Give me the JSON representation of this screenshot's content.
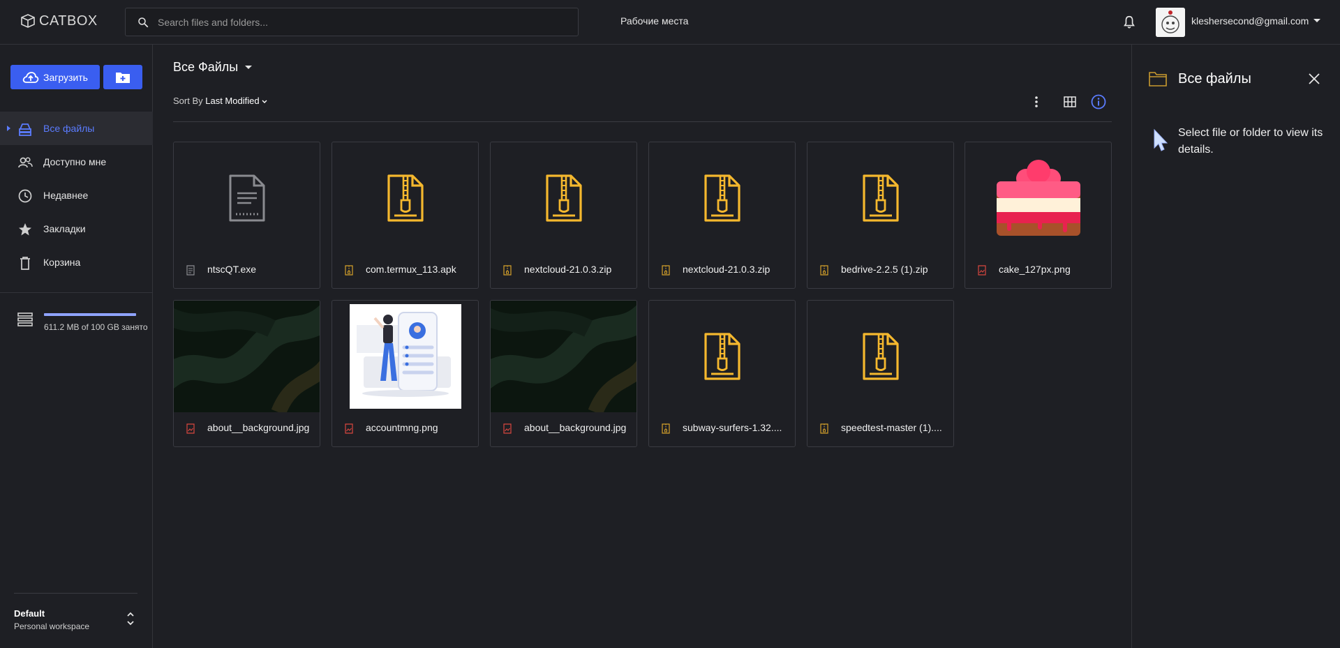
{
  "app": {
    "logo_text": "CATBOX"
  },
  "header": {
    "search_placeholder": "Search files and folders...",
    "workspaces_label": "Рабочие места",
    "user_email": "kleshersecond@gmail.com"
  },
  "sidebar": {
    "upload_label": "Загрузить",
    "nav": [
      {
        "label": "Все файлы",
        "icon": "all-files-icon",
        "active": true
      },
      {
        "label": "Доступно мне",
        "icon": "shared-people-icon"
      },
      {
        "label": "Недавнее",
        "icon": "clock-icon"
      },
      {
        "label": "Закладки",
        "icon": "star-icon"
      },
      {
        "label": "Корзина",
        "icon": "trash-icon"
      }
    ],
    "storage_text": "611.2 MB of 100 GB занято",
    "storage_fraction": 0.006,
    "workspace": {
      "name": "Default",
      "type": "Personal workspace"
    }
  },
  "main": {
    "title": "Все Файлы",
    "sort_prefix": "Sort By",
    "sort_value": "Last Modified",
    "files": [
      {
        "name": "ntscQT.exe",
        "kind": "document"
      },
      {
        "name": "com.termux_113.apk",
        "kind": "archive"
      },
      {
        "name": "nextcloud-21.0.3.zip",
        "kind": "archive"
      },
      {
        "name": "nextcloud-21.0.3.zip",
        "kind": "archive"
      },
      {
        "name": "bedrive-2.2.5 (1).zip",
        "kind": "archive"
      },
      {
        "name": "cake_127px.png",
        "kind": "image-cake"
      },
      {
        "name": "about__background.jpg",
        "kind": "image-dark"
      },
      {
        "name": "accountmng.png",
        "kind": "image-illustration"
      },
      {
        "name": "about__background.jpg",
        "kind": "image-dark"
      },
      {
        "name": "subway-surfers-1.32....",
        "kind": "archive"
      },
      {
        "name": "speedtest-master (1)....",
        "kind": "archive"
      }
    ]
  },
  "details": {
    "title": "Все файлы",
    "message": "Select file or folder to view its details."
  },
  "colors": {
    "accent": "#3a5ef0",
    "archive": "#f5b82e",
    "image": "#d9473f",
    "bg": "#1e1f24"
  }
}
